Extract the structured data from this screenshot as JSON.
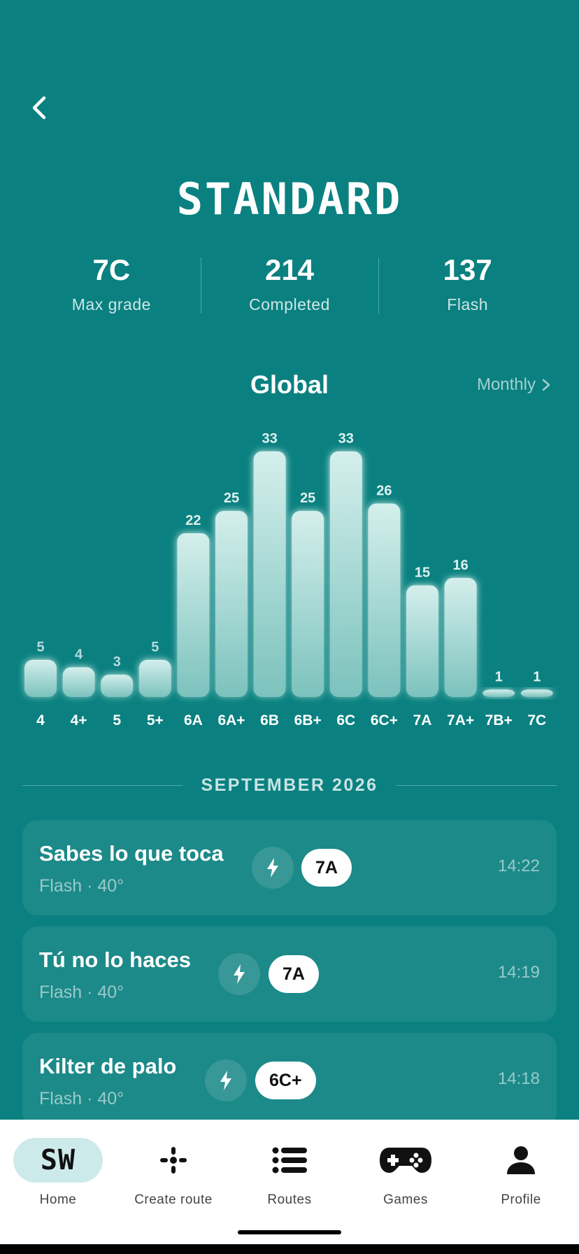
{
  "header": {
    "title": "STANDARD"
  },
  "stats": [
    {
      "value": "7C",
      "label": "Max grade"
    },
    {
      "value": "214",
      "label": "Completed"
    },
    {
      "value": "137",
      "label": "Flash"
    }
  ],
  "chart_header": {
    "title": "Global",
    "period": "Monthly"
  },
  "chart_data": {
    "type": "bar",
    "title": "Global",
    "categories": [
      "4",
      "4+",
      "5",
      "5+",
      "6A",
      "6A+",
      "6B",
      "6B+",
      "6C",
      "6C+",
      "7A",
      "7A+",
      "7B+",
      "7C"
    ],
    "values": [
      5,
      4,
      3,
      5,
      22,
      25,
      33,
      25,
      33,
      26,
      15,
      16,
      1,
      1
    ],
    "ylim": [
      0,
      33
    ],
    "grid": false
  },
  "log": {
    "month": "SEPTEMBER 2026",
    "entries": [
      {
        "name": "Sabes lo que toca",
        "meta": "Flash · 40°",
        "grade": "7A",
        "time": "14:22"
      },
      {
        "name": "Tú no lo haces",
        "meta": "Flash · 40°",
        "grade": "7A",
        "time": "14:19"
      },
      {
        "name": "Kilter de palo",
        "meta": "Flash · 40°",
        "grade": "6C+",
        "time": "14:18"
      }
    ]
  },
  "nav": {
    "home": "Home",
    "create": "Create route",
    "routes": "Routes",
    "games": "Games",
    "profile": "Profile",
    "logo_text": "SW"
  },
  "colors": {
    "background": "#0a8180",
    "bar_top": "#d4efec",
    "bar_bottom": "#7cc2bd",
    "nav_active": "#cdeaea"
  }
}
